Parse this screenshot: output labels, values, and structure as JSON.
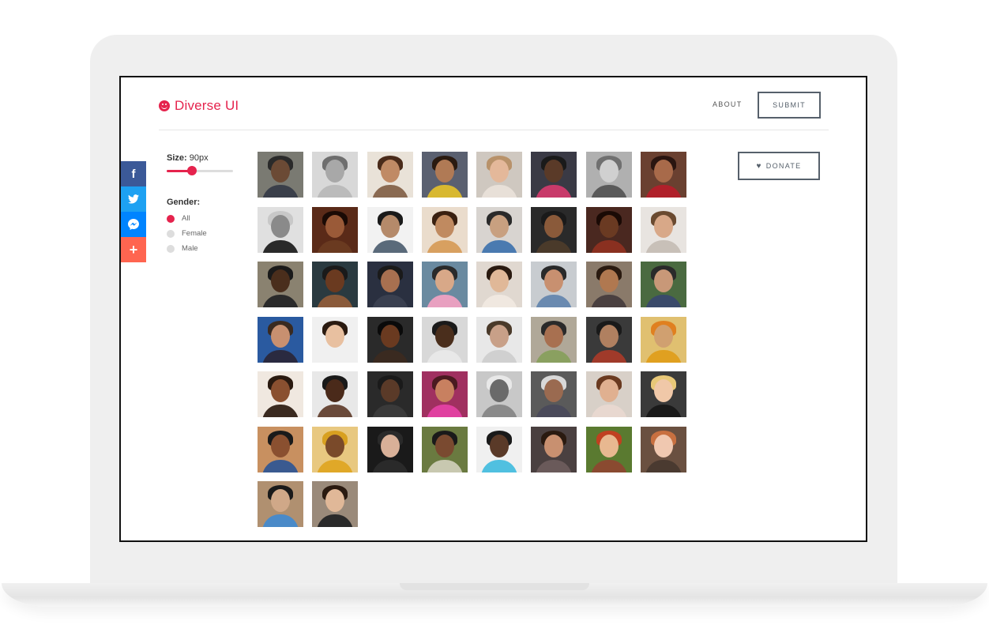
{
  "app": {
    "title": "Diverse UI",
    "accent_color": "#e5234d",
    "logo_icon": "smiley-icon"
  },
  "nav": {
    "about_label": "ABOUT",
    "submit_label": "SUBMIT"
  },
  "share": [
    {
      "name": "share-facebook",
      "icon": "facebook-icon",
      "glyph": "f"
    },
    {
      "name": "share-twitter",
      "icon": "twitter-icon",
      "glyph": "🐦"
    },
    {
      "name": "share-messenger",
      "icon": "messenger-icon",
      "glyph": "⚡"
    },
    {
      "name": "share-more",
      "icon": "plus-icon",
      "glyph": "+"
    }
  ],
  "filters": {
    "size_label": "Size:",
    "size_value": "90px",
    "size_fraction": 0.38,
    "gender_label": "Gender:",
    "gender_options": [
      {
        "label": "All",
        "selected": true
      },
      {
        "label": "Female",
        "selected": false
      },
      {
        "label": "Male",
        "selected": false
      }
    ]
  },
  "donate": {
    "label": "DONATE",
    "icon": "heart-icon"
  },
  "avatars": [
    {
      "bg": "#7a7a72",
      "skin": "#6b4a35",
      "hair": "#2a2a2a",
      "cloth": "#3a3f4a"
    },
    {
      "bg": "#d8d8d8",
      "skin": "#a8a8a8",
      "hair": "#6e6e6e",
      "cloth": "#bbbbbb"
    },
    {
      "bg": "#e9e2d8",
      "skin": "#c08a65",
      "hair": "#4a2b1a",
      "cloth": "#8a6a52"
    },
    {
      "bg": "#5a6070",
      "skin": "#b07a55",
      "hair": "#2a1a10",
      "cloth": "#d8b830"
    },
    {
      "bg": "#cfc8c0",
      "skin": "#e4b89a",
      "hair": "#b8926a",
      "cloth": "#e8e0d8"
    },
    {
      "bg": "#3a3a45",
      "skin": "#5a3a28",
      "hair": "#1a1a1a",
      "cloth": "#c83a6a"
    },
    {
      "bg": "#b0b0b0",
      "skin": "#d0d0d0",
      "hair": "#707070",
      "cloth": "#5a5a5a"
    },
    {
      "bg": "#6a4030",
      "skin": "#a86a4a",
      "hair": "#2a1510",
      "cloth": "#b0202a"
    },
    {
      "bg": "#e0e0e0",
      "skin": "#8a8a8a",
      "hair": "#c8c8c8",
      "cloth": "#2a2a2a"
    },
    {
      "bg": "#5a2a18",
      "skin": "#9a5a38",
      "hair": "#1a0a05",
      "cloth": "#6a3a20"
    },
    {
      "bg": "#f2f2f2",
      "skin": "#b58a6a",
      "hair": "#1a1a1a",
      "cloth": "#5a6a7a"
    },
    {
      "bg": "#eadccc",
      "skin": "#c08a60",
      "hair": "#3a2010",
      "cloth": "#d8a060"
    },
    {
      "bg": "#d8d4d0",
      "skin": "#c8a080",
      "hair": "#2a2a2a",
      "cloth": "#4a7ab0"
    },
    {
      "bg": "#2a2a2a",
      "skin": "#8a5a3a",
      "hair": "#1a1a1a",
      "cloth": "#4a3a2a"
    },
    {
      "bg": "#4a2820",
      "skin": "#6a3a22",
      "hair": "#1a0a05",
      "cloth": "#8a3020"
    },
    {
      "bg": "#e8e4e0",
      "skin": "#d8a888",
      "hair": "#6a4a30",
      "cloth": "#c8c0b8"
    },
    {
      "bg": "#8a8270",
      "skin": "#4a2e1c",
      "hair": "#1a1a1a",
      "cloth": "#2a2a2a"
    },
    {
      "bg": "#2a3a40",
      "skin": "#6a3a20",
      "hair": "#1a1a1a",
      "cloth": "#8a5a3a"
    },
    {
      "bg": "#2a3040",
      "skin": "#a87050",
      "hair": "#1a1a1a",
      "cloth": "#3a4050"
    },
    {
      "bg": "#6a8aa0",
      "skin": "#d8a888",
      "hair": "#2a2a2a",
      "cloth": "#e8a0c0"
    },
    {
      "bg": "#e0d8d0",
      "skin": "#e0b898",
      "hair": "#2a1a10",
      "cloth": "#f0e8e0"
    },
    {
      "bg": "#c8ccd0",
      "skin": "#c89070",
      "hair": "#2a2a2a",
      "cloth": "#6a8ab0"
    },
    {
      "bg": "#8a7a6a",
      "skin": "#b07850",
      "hair": "#2a1a10",
      "cloth": "#4a4040"
    },
    {
      "bg": "#4a6a40",
      "skin": "#c89878",
      "hair": "#2a2a2a",
      "cloth": "#3a4a6a"
    },
    {
      "bg": "#2a5aa0",
      "skin": "#c89070",
      "hair": "#3a2a20",
      "cloth": "#2a2a40"
    },
    {
      "bg": "#f0f0f0",
      "skin": "#e8c0a0",
      "hair": "#2a1a10",
      "cloth": "#f0f0f0"
    },
    {
      "bg": "#2a2a2a",
      "skin": "#6a3a20",
      "hair": "#0a0a0a",
      "cloth": "#3a2a20"
    },
    {
      "bg": "#d8d8d8",
      "skin": "#4a2e1c",
      "hair": "#1a1a1a",
      "cloth": "#e8e8e8"
    },
    {
      "bg": "#e8e8e8",
      "skin": "#c8a088",
      "hair": "#4a3a2a",
      "cloth": "#d0d0d0"
    },
    {
      "bg": "#b0a898",
      "skin": "#a87050",
      "hair": "#2a2a2a",
      "cloth": "#8aa060"
    },
    {
      "bg": "#3a3a3a",
      "skin": "#b08060",
      "hair": "#1a1a1a",
      "cloth": "#a03a2a"
    },
    {
      "bg": "#e0c070",
      "skin": "#d0a070",
      "hair": "#e08020",
      "cloth": "#e0a020"
    },
    {
      "bg": "#f0e8e0",
      "skin": "#8a5030",
      "hair": "#2a1a10",
      "cloth": "#3a2a20"
    },
    {
      "bg": "#e8e8e8",
      "skin": "#4a2a1a",
      "hair": "#1a1a1a",
      "cloth": "#6a4a3a"
    },
    {
      "bg": "#2a2a2a",
      "skin": "#5a3a28",
      "hair": "#1a1a1a",
      "cloth": "#3a3a3a"
    },
    {
      "bg": "#a03060",
      "skin": "#c88060",
      "hair": "#4a1a20",
      "cloth": "#e040a0"
    },
    {
      "bg": "#c8c8c8",
      "skin": "#6a6a6a",
      "hair": "#e8e8e8",
      "cloth": "#8a8a8a"
    },
    {
      "bg": "#5a5a5a",
      "skin": "#9a6a50",
      "hair": "#d8d8d8",
      "cloth": "#4a4a5a"
    },
    {
      "bg": "#d8d0c8",
      "skin": "#e0b090",
      "hair": "#6a3a20",
      "cloth": "#e8d8d0"
    },
    {
      "bg": "#3a3a3a",
      "skin": "#f0c8a8",
      "hair": "#e8c878",
      "cloth": "#1a1a1a"
    },
    {
      "bg": "#c89060",
      "skin": "#8a5030",
      "hair": "#1a1a1a",
      "cloth": "#3a5a90"
    },
    {
      "bg": "#e8c880",
      "skin": "#7a4a2a",
      "hair": "#d8a020",
      "cloth": "#e0a828"
    },
    {
      "bg": "#1a1a1a",
      "skin": "#d8b098",
      "hair": "#2a2a2a",
      "cloth": "#2a2a2a"
    },
    {
      "bg": "#6a7a40",
      "skin": "#7a4a30",
      "hair": "#1a1a1a",
      "cloth": "#c8c8b0"
    },
    {
      "bg": "#f0f0f0",
      "skin": "#5a3a28",
      "hair": "#1a1a1a",
      "cloth": "#50c0e0"
    },
    {
      "bg": "#4a4040",
      "skin": "#c89070",
      "hair": "#2a1a10",
      "cloth": "#6a5a5a"
    },
    {
      "bg": "#5a7a30",
      "skin": "#e8b890",
      "hair": "#c04020",
      "cloth": "#8a4a30"
    },
    {
      "bg": "#6a5040",
      "skin": "#f0c8b0",
      "hair": "#c87040",
      "cloth": "#4a3a30"
    },
    {
      "bg": "#b09070",
      "skin": "#d0a888",
      "hair": "#1a1a1a",
      "cloth": "#4a8ac8"
    },
    {
      "bg": "#9a8a7a",
      "skin": "#e0b898",
      "hair": "#2a1a10",
      "cloth": "#2a2a2a"
    }
  ]
}
